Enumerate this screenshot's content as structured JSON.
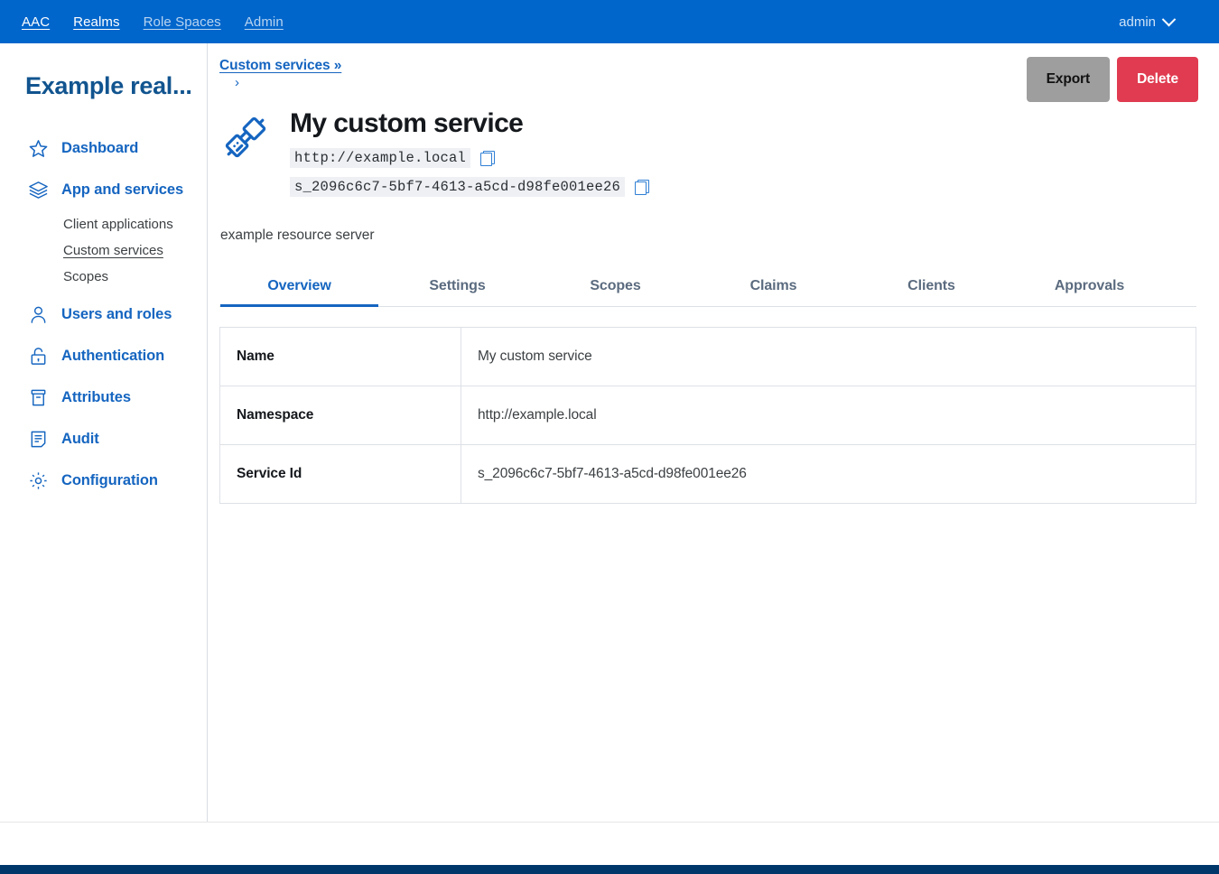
{
  "topnav": {
    "links": [
      {
        "label": "AAC",
        "dim": false
      },
      {
        "label": "Realms",
        "dim": false
      },
      {
        "label": "Role Spaces",
        "dim": true
      },
      {
        "label": "Admin",
        "dim": true
      }
    ],
    "user": "admin",
    "chevron_icon": "chevron-down-icon",
    "background": "#0066cc"
  },
  "sidebar": {
    "realm_title": "Example real...",
    "items": [
      {
        "label": "Dashboard",
        "icon": "star-icon"
      },
      {
        "label": "App and services",
        "icon": "layers-icon"
      },
      {
        "label": "Users and roles",
        "icon": "user-icon"
      },
      {
        "label": "Authentication",
        "icon": "lock-icon"
      },
      {
        "label": "Attributes",
        "icon": "archive-box-icon"
      },
      {
        "label": "Audit",
        "icon": "document-lines-icon"
      },
      {
        "label": "Configuration",
        "icon": "gear-icon"
      }
    ],
    "sub_items": [
      {
        "label": "Client applications",
        "active": false
      },
      {
        "label": "Custom services",
        "active": true
      },
      {
        "label": "Scopes",
        "active": false
      }
    ],
    "accent": "#1565c0"
  },
  "actions": {
    "export_label": "Export",
    "delete_label": "Delete",
    "export_color": "#9e9e9e",
    "delete_color": "#e03b50"
  },
  "breadcrumb": {
    "link_label": "Custom services »",
    "chevron": "›"
  },
  "hero": {
    "icon": "plug-connector-icon",
    "title": "My custom service",
    "namespace_chip": "http://example.local",
    "service_id_chip": "s_2096c6c7-5bf7-4613-a5cd-d98fe001ee26",
    "copy_icon": "copy-icon",
    "description": "example resource server"
  },
  "tabs": [
    {
      "label": "Overview",
      "active": true
    },
    {
      "label": "Settings",
      "active": false
    },
    {
      "label": "Scopes",
      "active": false
    },
    {
      "label": "Claims",
      "active": false
    },
    {
      "label": "Clients",
      "active": false
    },
    {
      "label": "Approvals",
      "active": false
    }
  ],
  "overview_table": {
    "rows": [
      {
        "key": "Name",
        "value": "My custom service"
      },
      {
        "key": "Namespace",
        "value": "http://example.local"
      },
      {
        "key": "Service Id",
        "value": "s_2096c6c7-5bf7-4613-a5cd-d98fe001ee26"
      }
    ]
  },
  "footer": {
    "color": "#00376b"
  }
}
